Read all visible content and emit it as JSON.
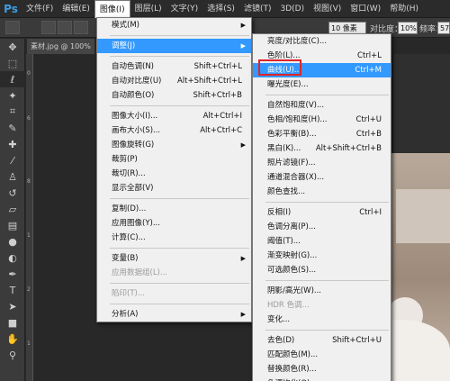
{
  "menubar": {
    "logo": "Ps",
    "items": [
      "文件(F)",
      "编辑(E)",
      "图像(I)",
      "图层(L)",
      "文字(Y)",
      "选择(S)",
      "滤镜(T)",
      "3D(D)",
      "视图(V)",
      "窗口(W)",
      "帮助(H)"
    ]
  },
  "options": {
    "size_field": "10 像素",
    "contrast_label": "对比度：",
    "contrast_value": "10%",
    "freq_label": "频率：",
    "freq_value": "57"
  },
  "tab": {
    "label": "素材.jpg @ 100%"
  },
  "ruler": {
    "ticks": [
      "0",
      "6",
      "8",
      "1",
      "2",
      "1"
    ]
  },
  "image_menu": {
    "items": [
      {
        "label": "模式(M)",
        "shortcut": "",
        "arrow": "▶",
        "disabled": false,
        "highlight": false
      },
      {
        "sep": true
      },
      {
        "label": "调整(J)",
        "shortcut": "",
        "arrow": "▶",
        "disabled": false,
        "highlight": true
      },
      {
        "sep": true
      },
      {
        "label": "自动色调(N)",
        "shortcut": "Shift+Ctrl+L",
        "arrow": "",
        "disabled": false,
        "highlight": false
      },
      {
        "label": "自动对比度(U)",
        "shortcut": "Alt+Shift+Ctrl+L",
        "arrow": "",
        "disabled": false,
        "highlight": false
      },
      {
        "label": "自动颜色(O)",
        "shortcut": "Shift+Ctrl+B",
        "arrow": "",
        "disabled": false,
        "highlight": false
      },
      {
        "sep": true
      },
      {
        "label": "图像大小(I)...",
        "shortcut": "Alt+Ctrl+I",
        "arrow": "",
        "disabled": false,
        "highlight": false
      },
      {
        "label": "画布大小(S)...",
        "shortcut": "Alt+Ctrl+C",
        "arrow": "",
        "disabled": false,
        "highlight": false
      },
      {
        "label": "图像旋转(G)",
        "shortcut": "",
        "arrow": "▶",
        "disabled": false,
        "highlight": false
      },
      {
        "label": "裁剪(P)",
        "shortcut": "",
        "arrow": "",
        "disabled": false,
        "highlight": false
      },
      {
        "label": "裁切(R)...",
        "shortcut": "",
        "arrow": "",
        "disabled": false,
        "highlight": false
      },
      {
        "label": "显示全部(V)",
        "shortcut": "",
        "arrow": "",
        "disabled": false,
        "highlight": false
      },
      {
        "sep": true
      },
      {
        "label": "复制(D)...",
        "shortcut": "",
        "arrow": "",
        "disabled": false,
        "highlight": false
      },
      {
        "label": "应用图像(Y)...",
        "shortcut": "",
        "arrow": "",
        "disabled": false,
        "highlight": false
      },
      {
        "label": "计算(C)...",
        "shortcut": "",
        "arrow": "",
        "disabled": false,
        "highlight": false
      },
      {
        "sep": true
      },
      {
        "label": "变量(B)",
        "shortcut": "",
        "arrow": "▶",
        "disabled": false,
        "highlight": false
      },
      {
        "label": "应用数据组(L)...",
        "shortcut": "",
        "arrow": "",
        "disabled": true,
        "highlight": false
      },
      {
        "sep": true
      },
      {
        "label": "陷印(T)...",
        "shortcut": "",
        "arrow": "",
        "disabled": true,
        "highlight": false
      },
      {
        "sep": true
      },
      {
        "label": "分析(A)",
        "shortcut": "",
        "arrow": "▶",
        "disabled": false,
        "highlight": false
      }
    ]
  },
  "adjust_menu": {
    "items": [
      {
        "label": "亮度/对比度(C)...",
        "shortcut": "",
        "disabled": false,
        "highlight": false
      },
      {
        "label": "色阶(L)...",
        "shortcut": "Ctrl+L",
        "disabled": false,
        "highlight": false
      },
      {
        "label": "曲线(U)...",
        "shortcut": "Ctrl+M",
        "disabled": false,
        "highlight": true
      },
      {
        "label": "曝光度(E)...",
        "shortcut": "",
        "disabled": false,
        "highlight": false
      },
      {
        "sep": true
      },
      {
        "label": "自然饱和度(V)...",
        "shortcut": "",
        "disabled": false,
        "highlight": false
      },
      {
        "label": "色相/饱和度(H)...",
        "shortcut": "Ctrl+U",
        "disabled": false,
        "highlight": false
      },
      {
        "label": "色彩平衡(B)...",
        "shortcut": "Ctrl+B",
        "disabled": false,
        "highlight": false
      },
      {
        "label": "黑白(K)...",
        "shortcut": "Alt+Shift+Ctrl+B",
        "disabled": false,
        "highlight": false
      },
      {
        "label": "照片滤镜(F)...",
        "shortcut": "",
        "disabled": false,
        "highlight": false
      },
      {
        "label": "通道混合器(X)...",
        "shortcut": "",
        "disabled": false,
        "highlight": false
      },
      {
        "label": "颜色查找...",
        "shortcut": "",
        "disabled": false,
        "highlight": false
      },
      {
        "sep": true
      },
      {
        "label": "反相(I)",
        "shortcut": "Ctrl+I",
        "disabled": false,
        "highlight": false
      },
      {
        "label": "色调分离(P)...",
        "shortcut": "",
        "disabled": false,
        "highlight": false
      },
      {
        "label": "阈值(T)...",
        "shortcut": "",
        "disabled": false,
        "highlight": false
      },
      {
        "label": "渐变映射(G)...",
        "shortcut": "",
        "disabled": false,
        "highlight": false
      },
      {
        "label": "可选颜色(S)...",
        "shortcut": "",
        "disabled": false,
        "highlight": false
      },
      {
        "sep": true
      },
      {
        "label": "阴影/高光(W)...",
        "shortcut": "",
        "disabled": false,
        "highlight": false
      },
      {
        "label": "HDR 色调...",
        "shortcut": "",
        "disabled": true,
        "highlight": false
      },
      {
        "label": "变化...",
        "shortcut": "",
        "disabled": false,
        "highlight": false
      },
      {
        "sep": true
      },
      {
        "label": "去色(D)",
        "shortcut": "Shift+Ctrl+U",
        "disabled": false,
        "highlight": false
      },
      {
        "label": "匹配颜色(M)...",
        "shortcut": "",
        "disabled": false,
        "highlight": false
      },
      {
        "label": "替换颜色(R)...",
        "shortcut": "",
        "disabled": false,
        "highlight": false
      },
      {
        "label": "色调均化(Q)",
        "shortcut": "",
        "disabled": false,
        "highlight": false
      }
    ]
  },
  "tools": [
    "move-tool-icon",
    "marquee-tool-icon",
    "lasso-tool-icon",
    "magic-wand-icon",
    "crop-tool-icon",
    "eyedropper-icon",
    "healing-brush-icon",
    "brush-tool-icon",
    "clone-stamp-icon",
    "history-brush-icon",
    "eraser-icon",
    "gradient-tool-icon",
    "blur-tool-icon",
    "dodge-tool-icon",
    "pen-tool-icon",
    "type-tool-icon",
    "path-select-icon",
    "shape-tool-icon",
    "hand-tool-icon",
    "zoom-tool-icon"
  ],
  "colors": {
    "highlight": "#3399ff",
    "annotation": "#e0242a",
    "logo": "#3e9de0"
  }
}
